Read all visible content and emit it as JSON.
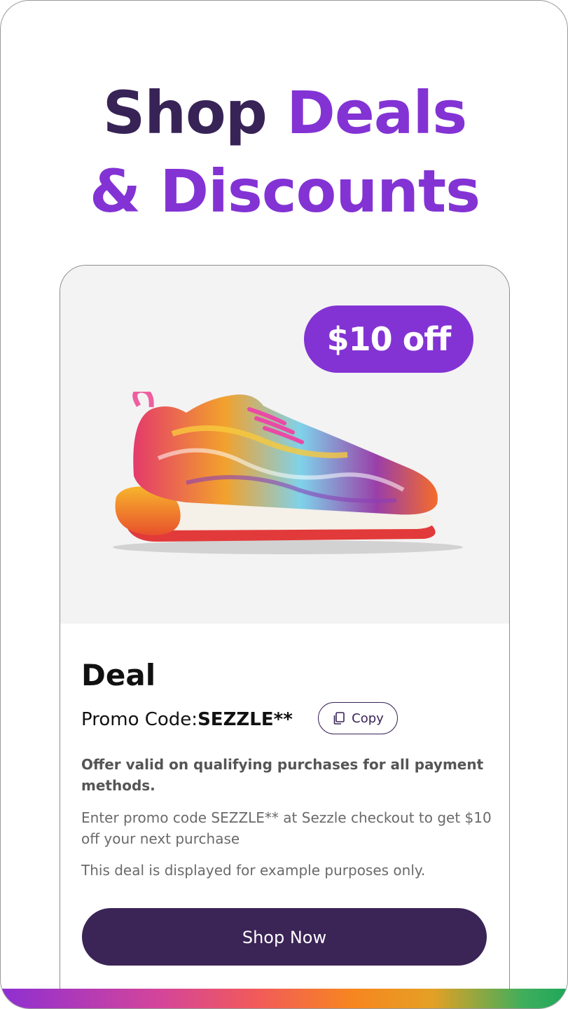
{
  "headline": {
    "line1_dark": "Shop",
    "line1_accent": "Deals",
    "line2_accent": "& Discounts"
  },
  "card": {
    "badge": "$10 off",
    "product_image": "colorful-sneaker",
    "title": "Deal",
    "promo_label": "Promo Code: ",
    "promo_code": "SEZZLE**",
    "copy_label": "Copy",
    "copy_icon": "copy-icon",
    "offer_text": "Offer valid on qualifying purchases for all payment methods.",
    "instructions": "Enter promo code SEZZLE** at Sezzle checkout to get $10 off your next purchase",
    "disclaimer": "This deal is displayed for example purposes only.",
    "cta_label": "Shop Now"
  },
  "colors": {
    "brand_dark": "#382357",
    "brand_accent": "#8333d4",
    "button_bg": "#3b2456"
  }
}
